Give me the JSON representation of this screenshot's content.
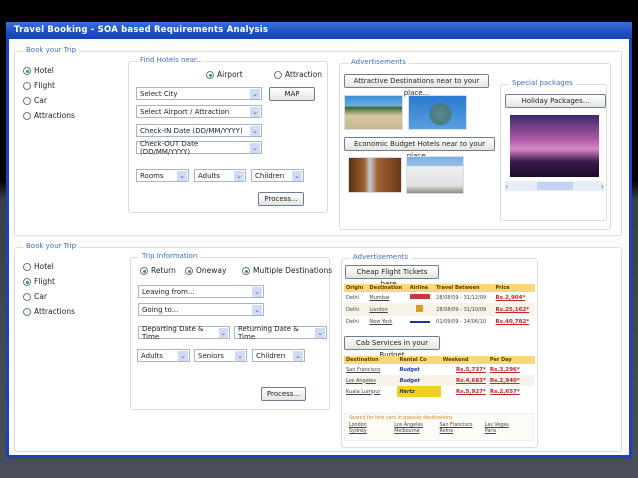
{
  "window": {
    "title": "Travel Booking - SOA based Requirements Analysis"
  },
  "hotel_section": {
    "legend": "Book your Trip",
    "modes": [
      {
        "label": "Hotel",
        "checked": true
      },
      {
        "label": "Flight",
        "checked": false
      },
      {
        "label": "Car",
        "checked": false
      },
      {
        "label": "Attractions",
        "checked": false
      }
    ],
    "find": {
      "legend": "Find Hotels near...",
      "near": [
        {
          "label": "Airport",
          "checked": true
        },
        {
          "label": "Attraction",
          "checked": false
        }
      ],
      "city": "Select City",
      "airport": "Select Airport / Attraction",
      "checkin": "Check-IN Date (DD/MM/YYYY)",
      "checkout": "Check-OUT Date (DD/MM/YYYY)",
      "map": "MAP",
      "rooms": "Rooms",
      "adults": "Adults",
      "children": "Children",
      "process": "Process..."
    },
    "ads": {
      "legend": "Advertisements",
      "attractive": "Attractive Destinations near to your place...",
      "budget": "Economic Budget Hotels near to your place...",
      "special_legend": "Special packages",
      "holiday": "Holiday Packages..."
    }
  },
  "flight_section": {
    "legend": "Book your Trip",
    "modes": [
      {
        "label": "Hotel",
        "checked": false
      },
      {
        "label": "Flight",
        "checked": true
      },
      {
        "label": "Car",
        "checked": false
      },
      {
        "label": "Attractions",
        "checked": false
      }
    ],
    "trip": {
      "legend": "Trip Information",
      "types": [
        {
          "label": "Return",
          "checked": true
        },
        {
          "label": "Oneway",
          "checked": true
        },
        {
          "label": "Multiple Destinations",
          "checked": true
        }
      ],
      "leaving": "Leaving from...",
      "going": "Going to...",
      "departing": "Departing Date & Time",
      "returning": "Returning Date & Time",
      "adults": "Adults",
      "seniors": "Seniors",
      "children": "Children",
      "process": "Process..."
    },
    "ads": {
      "legend": "Advertisements",
      "cheap": "Cheap Flight Tickets here...",
      "flights_headers": [
        "Origin",
        "Destination",
        "Airline",
        "Travel Between",
        "Price"
      ],
      "flights": [
        [
          "Delhi",
          "Mumbai",
          "",
          "28/08/09 - 31/12/09",
          "Rs.2,904*"
        ],
        [
          "Delhi",
          "London",
          "",
          "28/08/09 - 31/10/09",
          "Rs.25,162*"
        ],
        [
          "Delhi",
          "New York",
          "",
          "01/09/09 - 14/06/10",
          "Rs.40,782*"
        ]
      ],
      "cab": "Cab Services in your Budget",
      "cab_headers": [
        "Destination",
        "Rental Co",
        "Weekend",
        "Per Day"
      ],
      "cabs": [
        [
          "San Francisco",
          "Budget",
          "Rs.5,737*",
          "Rs.3,296*"
        ],
        [
          "Los Angeles",
          "Budget",
          "Rs.4,683*",
          "Rs.2,940*"
        ],
        [
          "Kuala Lumpur",
          "Hertz",
          "Rs.5,927*",
          "Rs.2,657*"
        ]
      ],
      "search_title": "Search for hire cars in popular destinations",
      "destinations": [
        "London",
        "Los Angeles",
        "San Francisco",
        "Las Vegas",
        "Sydney",
        "Melbourne",
        "Rome",
        "Paris"
      ]
    }
  }
}
